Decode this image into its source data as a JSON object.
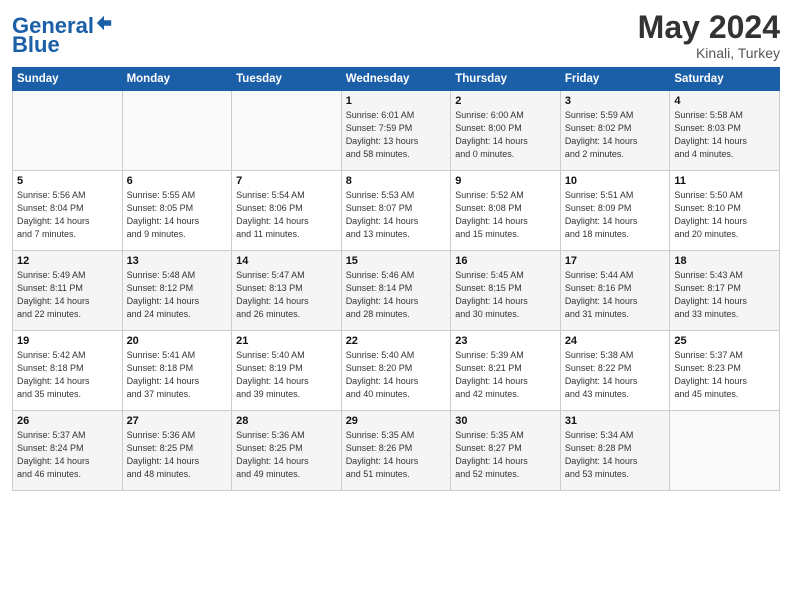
{
  "header": {
    "logo_text1": "General",
    "logo_text2": "Blue",
    "month_year": "May 2024",
    "location": "Kinali, Turkey"
  },
  "days_of_week": [
    "Sunday",
    "Monday",
    "Tuesday",
    "Wednesday",
    "Thursday",
    "Friday",
    "Saturday"
  ],
  "weeks": [
    [
      {
        "day": "",
        "content": ""
      },
      {
        "day": "",
        "content": ""
      },
      {
        "day": "",
        "content": ""
      },
      {
        "day": "1",
        "content": "Sunrise: 6:01 AM\nSunset: 7:59 PM\nDaylight: 13 hours\nand 58 minutes."
      },
      {
        "day": "2",
        "content": "Sunrise: 6:00 AM\nSunset: 8:00 PM\nDaylight: 14 hours\nand 0 minutes."
      },
      {
        "day": "3",
        "content": "Sunrise: 5:59 AM\nSunset: 8:02 PM\nDaylight: 14 hours\nand 2 minutes."
      },
      {
        "day": "4",
        "content": "Sunrise: 5:58 AM\nSunset: 8:03 PM\nDaylight: 14 hours\nand 4 minutes."
      }
    ],
    [
      {
        "day": "5",
        "content": "Sunrise: 5:56 AM\nSunset: 8:04 PM\nDaylight: 14 hours\nand 7 minutes."
      },
      {
        "day": "6",
        "content": "Sunrise: 5:55 AM\nSunset: 8:05 PM\nDaylight: 14 hours\nand 9 minutes."
      },
      {
        "day": "7",
        "content": "Sunrise: 5:54 AM\nSunset: 8:06 PM\nDaylight: 14 hours\nand 11 minutes."
      },
      {
        "day": "8",
        "content": "Sunrise: 5:53 AM\nSunset: 8:07 PM\nDaylight: 14 hours\nand 13 minutes."
      },
      {
        "day": "9",
        "content": "Sunrise: 5:52 AM\nSunset: 8:08 PM\nDaylight: 14 hours\nand 15 minutes."
      },
      {
        "day": "10",
        "content": "Sunrise: 5:51 AM\nSunset: 8:09 PM\nDaylight: 14 hours\nand 18 minutes."
      },
      {
        "day": "11",
        "content": "Sunrise: 5:50 AM\nSunset: 8:10 PM\nDaylight: 14 hours\nand 20 minutes."
      }
    ],
    [
      {
        "day": "12",
        "content": "Sunrise: 5:49 AM\nSunset: 8:11 PM\nDaylight: 14 hours\nand 22 minutes."
      },
      {
        "day": "13",
        "content": "Sunrise: 5:48 AM\nSunset: 8:12 PM\nDaylight: 14 hours\nand 24 minutes."
      },
      {
        "day": "14",
        "content": "Sunrise: 5:47 AM\nSunset: 8:13 PM\nDaylight: 14 hours\nand 26 minutes."
      },
      {
        "day": "15",
        "content": "Sunrise: 5:46 AM\nSunset: 8:14 PM\nDaylight: 14 hours\nand 28 minutes."
      },
      {
        "day": "16",
        "content": "Sunrise: 5:45 AM\nSunset: 8:15 PM\nDaylight: 14 hours\nand 30 minutes."
      },
      {
        "day": "17",
        "content": "Sunrise: 5:44 AM\nSunset: 8:16 PM\nDaylight: 14 hours\nand 31 minutes."
      },
      {
        "day": "18",
        "content": "Sunrise: 5:43 AM\nSunset: 8:17 PM\nDaylight: 14 hours\nand 33 minutes."
      }
    ],
    [
      {
        "day": "19",
        "content": "Sunrise: 5:42 AM\nSunset: 8:18 PM\nDaylight: 14 hours\nand 35 minutes."
      },
      {
        "day": "20",
        "content": "Sunrise: 5:41 AM\nSunset: 8:18 PM\nDaylight: 14 hours\nand 37 minutes."
      },
      {
        "day": "21",
        "content": "Sunrise: 5:40 AM\nSunset: 8:19 PM\nDaylight: 14 hours\nand 39 minutes."
      },
      {
        "day": "22",
        "content": "Sunrise: 5:40 AM\nSunset: 8:20 PM\nDaylight: 14 hours\nand 40 minutes."
      },
      {
        "day": "23",
        "content": "Sunrise: 5:39 AM\nSunset: 8:21 PM\nDaylight: 14 hours\nand 42 minutes."
      },
      {
        "day": "24",
        "content": "Sunrise: 5:38 AM\nSunset: 8:22 PM\nDaylight: 14 hours\nand 43 minutes."
      },
      {
        "day": "25",
        "content": "Sunrise: 5:37 AM\nSunset: 8:23 PM\nDaylight: 14 hours\nand 45 minutes."
      }
    ],
    [
      {
        "day": "26",
        "content": "Sunrise: 5:37 AM\nSunset: 8:24 PM\nDaylight: 14 hours\nand 46 minutes."
      },
      {
        "day": "27",
        "content": "Sunrise: 5:36 AM\nSunset: 8:25 PM\nDaylight: 14 hours\nand 48 minutes."
      },
      {
        "day": "28",
        "content": "Sunrise: 5:36 AM\nSunset: 8:25 PM\nDaylight: 14 hours\nand 49 minutes."
      },
      {
        "day": "29",
        "content": "Sunrise: 5:35 AM\nSunset: 8:26 PM\nDaylight: 14 hours\nand 51 minutes."
      },
      {
        "day": "30",
        "content": "Sunrise: 5:35 AM\nSunset: 8:27 PM\nDaylight: 14 hours\nand 52 minutes."
      },
      {
        "day": "31",
        "content": "Sunrise: 5:34 AM\nSunset: 8:28 PM\nDaylight: 14 hours\nand 53 minutes."
      },
      {
        "day": "",
        "content": ""
      }
    ]
  ]
}
